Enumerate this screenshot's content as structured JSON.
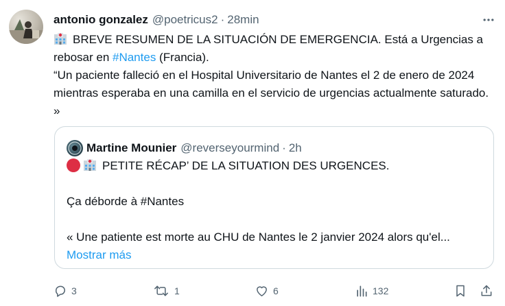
{
  "author": {
    "name": "antonio gonzalez",
    "handle": "@poetricus2",
    "time": "28min"
  },
  "tweet": {
    "line1_prefix": "BREVE RESUMEN DE LA SITUACIÓN DE EMERGENCIA. Está a Urgencias a",
    "line2_prefix": "rebosar en ",
    "hashtag": "#Nantes",
    "line2_suffix": " (Francia).",
    "quote_text": "“Un paciente falleció en el Hospital Universitario de Nantes el 2 de enero de 2024 mientras esperaba en una camilla en el servicio de urgencias actualmente saturado. »"
  },
  "quoted": {
    "name": "Martine Mounier",
    "handle": "@reverseyourmind",
    "time": "2h",
    "line1": "PETITE RÉCAP’ DE LA SITUATION DES URGENCES.",
    "line2": "Ça déborde à #Nantes",
    "line3": "« Une patiente est morte au CHU de Nantes le 2 janvier 2024 alors qu'el...",
    "show_more": "Mostrar más"
  },
  "actions": {
    "replies": "3",
    "retweets": "1",
    "likes": "6",
    "views": "132"
  },
  "icons": {
    "more": "more-horizontal-icon",
    "reply": "reply-icon",
    "retweet": "retweet-icon",
    "like": "heart-icon",
    "views": "views-icon",
    "bookmark": "bookmark-icon",
    "share": "share-icon",
    "hospital": "hospital-emoji",
    "red_circle": "red-circle-emoji"
  },
  "colors": {
    "link": "#1d9bf0",
    "muted": "#536471",
    "border": "#cfd9de",
    "text": "#0f1419"
  }
}
